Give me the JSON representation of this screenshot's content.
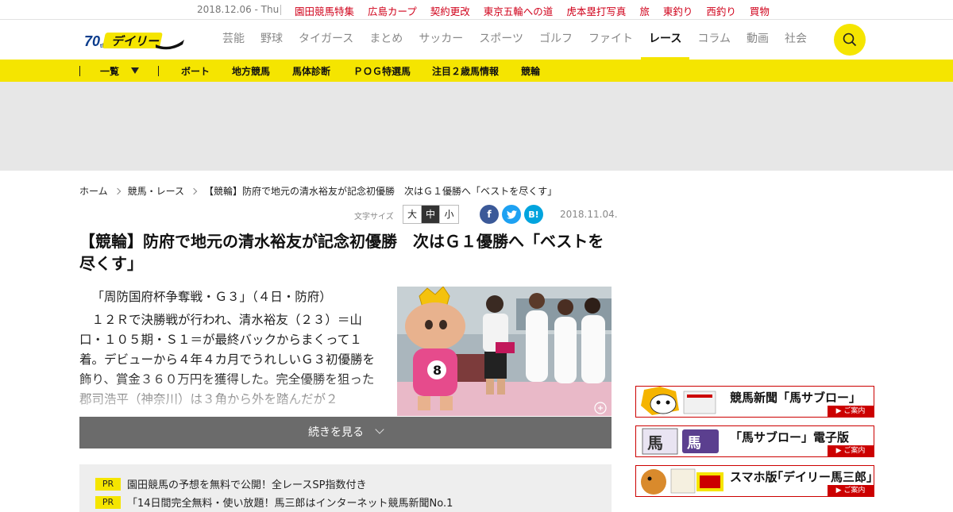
{
  "topbar": {
    "date": "2018.12.06 - Thu",
    "links": [
      "園田競馬特集",
      "広島カープ",
      "契約更改",
      "東京五輪への道",
      "虎本塁打写真",
      "旅",
      "東釣り",
      "西釣り",
      "買物"
    ]
  },
  "header": {
    "logo_text": "デイリー",
    "nav": [
      "芸能",
      "野球",
      "タイガース",
      "まとめ",
      "サッカー",
      "スポーツ",
      "ゴルフ",
      "ファイト",
      "レース",
      "コラム",
      "動画",
      "社会"
    ],
    "active_nav": "レース"
  },
  "subnav": {
    "dropdown": "一覧",
    "items": [
      "ボート",
      "地方競馬",
      "馬体診断",
      "ＰＯＧ特選馬",
      "注目２歳馬情報",
      "競輪"
    ]
  },
  "breadcrumb": [
    "ホーム",
    "競馬・レース",
    "【競輪】防府で地元の清水裕友が記念初優勝　次はＧ１優勝へ「ベストを尽くす」"
  ],
  "tools": {
    "fontsize_label": "文字サイズ",
    "sizes": [
      "大",
      "中",
      "小"
    ],
    "selected_size": "中",
    "date": "2018.11.04."
  },
  "article": {
    "headline": "【競輪】防府で地元の清水裕友が記念初優勝　次はＧ１優勝へ「ベストを尽くす」",
    "lead": "「周防国府杯争奪戦・Ｇ３」（４日・防府）",
    "body": "１２Ｒで決勝戦が行われ、清水裕友（２３）＝山口・１０５期・Ｓ１＝が最終バックからまくって１着。デビューから４年４カ月でうれしいＧ３初優勝を飾り、賞金３６０万円を獲得した。完全優勝を狙った郡司浩平（神奈川）は３角から外を踏んだが２",
    "read_more": "続きを見る"
  },
  "pr": [
    {
      "badge": "PR",
      "text": "園田競馬の予想を無料で公開！全レースSP指数付き"
    },
    {
      "badge": "PR",
      "text": "「14日間完全無料・使い放題！馬三郎はインターネット競馬新聞No.1"
    }
  ],
  "sidebar": [
    {
      "title": "競馬新聞「馬サブロー」",
      "guide": "▶ ご案内"
    },
    {
      "title": "「馬サブロー」電子版",
      "guide": "▶ ご案内"
    },
    {
      "title": "スマホ版｢デイリー馬三郎｣",
      "guide": "▶ ご案内"
    }
  ],
  "colors": {
    "accent": "#f5e500",
    "link_red": "#d0021b",
    "banner_red": "#cc0000"
  }
}
